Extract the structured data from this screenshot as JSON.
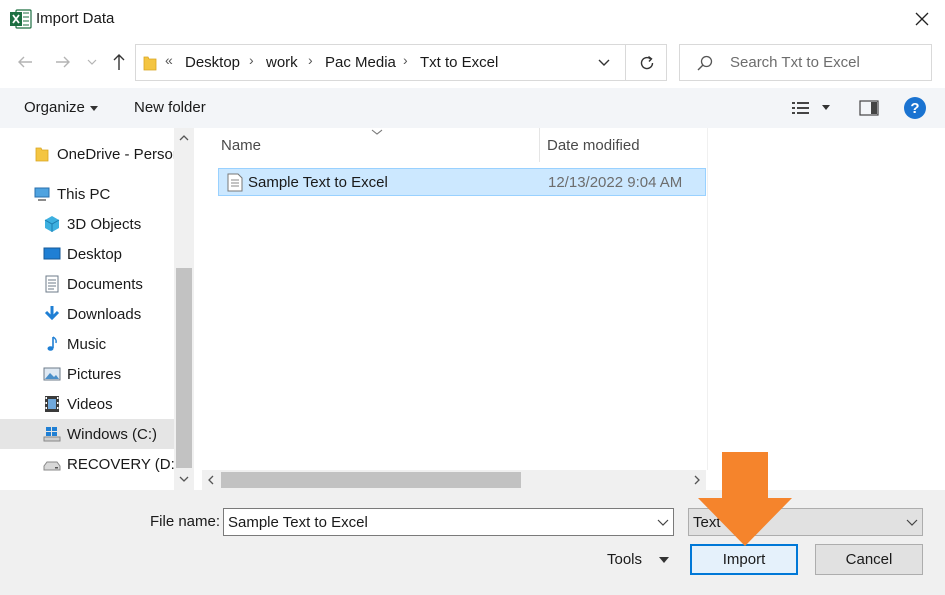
{
  "window": {
    "title": "Import Data",
    "app_icon": "excel-icon"
  },
  "address_bar": {
    "overflow_glyph": "«",
    "breadcrumbs": [
      "Desktop",
      "work",
      "Pac Media",
      "Txt to Excel"
    ],
    "separator_glyph": "›"
  },
  "search": {
    "placeholder": "Search Txt to Excel"
  },
  "toolbar": {
    "organize_label": "Organize",
    "new_folder_label": "New folder",
    "help_glyph": "?"
  },
  "nav": {
    "items": [
      {
        "label": "OneDrive - Person",
        "icon": "folder-icon"
      },
      {
        "label": "This PC",
        "icon": "pc-icon"
      },
      {
        "label": "3D Objects",
        "icon": "cube-icon"
      },
      {
        "label": "Desktop",
        "icon": "desktop-icon"
      },
      {
        "label": "Documents",
        "icon": "documents-icon"
      },
      {
        "label": "Downloads",
        "icon": "download-icon"
      },
      {
        "label": "Music",
        "icon": "music-icon"
      },
      {
        "label": "Pictures",
        "icon": "pictures-icon"
      },
      {
        "label": "Videos",
        "icon": "videos-icon"
      },
      {
        "label": "Windows (C:)",
        "icon": "windows-drive-icon",
        "selected": true
      },
      {
        "label": "RECOVERY (D:)",
        "icon": "drive-icon"
      }
    ]
  },
  "file_list": {
    "columns": {
      "name": "Name",
      "date": "Date modified"
    },
    "rows": [
      {
        "name": "Sample Text to Excel",
        "date": "12/13/2022 9:04 AM",
        "selected": true
      }
    ]
  },
  "footer": {
    "file_name_label": "File name:",
    "file_name_value": "Sample Text to Excel",
    "file_type_value": "Text",
    "tools_label": "Tools",
    "import_label": "Import",
    "cancel_label": "Cancel"
  },
  "colors": {
    "selection": "#cce8ff",
    "accent": "#0078d7",
    "annotation_arrow": "#f5842c"
  }
}
